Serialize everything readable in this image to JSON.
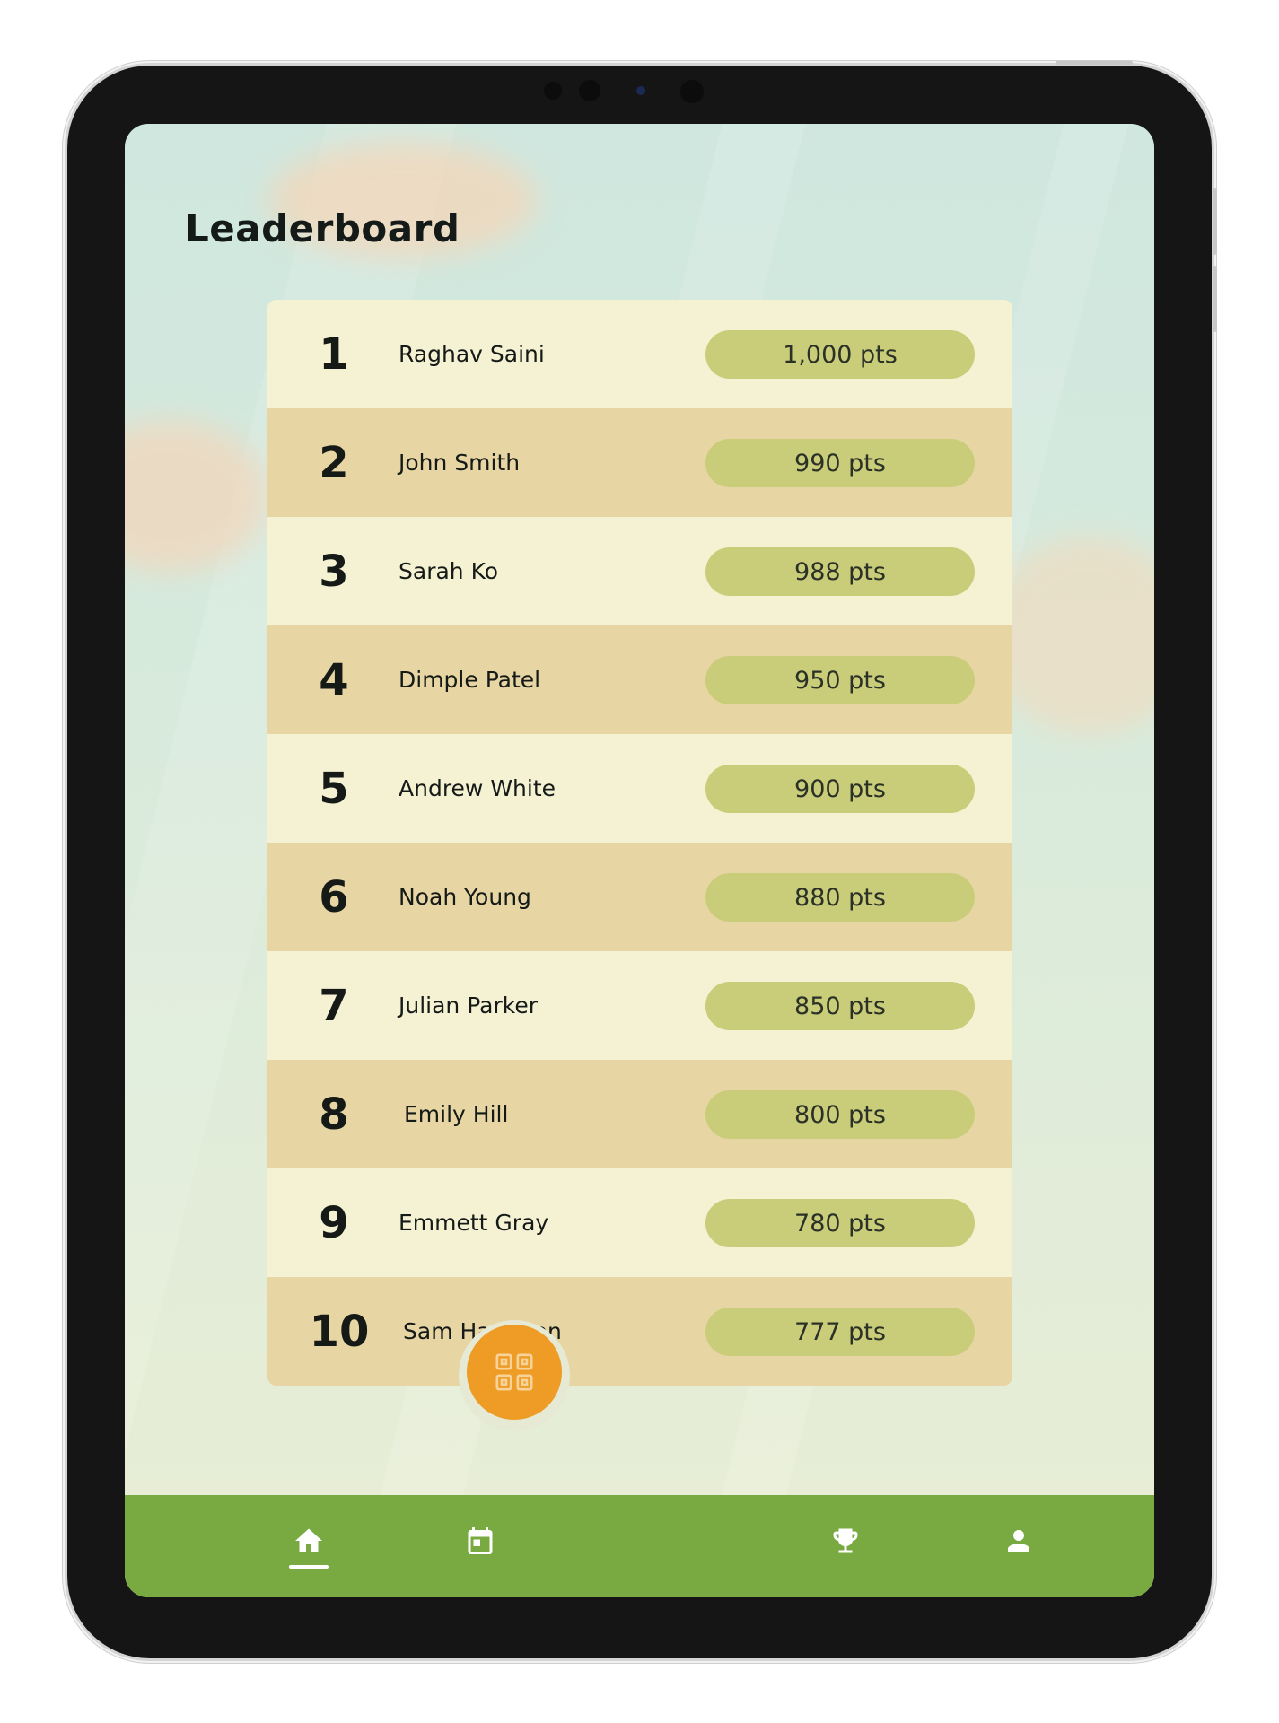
{
  "page": {
    "title": "Leaderboard"
  },
  "leaderboard": [
    {
      "rank": "1",
      "name": "Raghav Saini",
      "points": "1,000 pts"
    },
    {
      "rank": "2",
      "name": "John Smith",
      "points": "990 pts"
    },
    {
      "rank": "3",
      "name": "Sarah Ko",
      "points": "988 pts"
    },
    {
      "rank": "4",
      "name": "Dimple Patel",
      "points": "950 pts"
    },
    {
      "rank": "5",
      "name": "Andrew White",
      "points": "900 pts"
    },
    {
      "rank": "6",
      "name": "Noah Young",
      "points": "880 pts"
    },
    {
      "rank": "7",
      "name": "Julian Parker",
      "points": "850 pts"
    },
    {
      "rank": "8",
      "name": "Emily Hill",
      "points": "800 pts"
    },
    {
      "rank": "9",
      "name": "Emmett Gray",
      "points": "780 pts"
    },
    {
      "rank": "10",
      "name": "Sam Hamilton",
      "points": "777 pts"
    }
  ],
  "nav": {
    "items": [
      {
        "icon": "home-icon",
        "active": true
      },
      {
        "icon": "calendar-icon",
        "active": false
      },
      {
        "icon": "trophy-icon",
        "active": false
      },
      {
        "icon": "profile-icon",
        "active": false
      }
    ],
    "fab_icon": "qr-code-icon"
  },
  "colors": {
    "row_light": "#f5f2d4",
    "row_dark": "#e7d5a4",
    "points_pill": "#c9cd79",
    "nav_bar": "#79aa42",
    "fab": "#ee9c25"
  }
}
